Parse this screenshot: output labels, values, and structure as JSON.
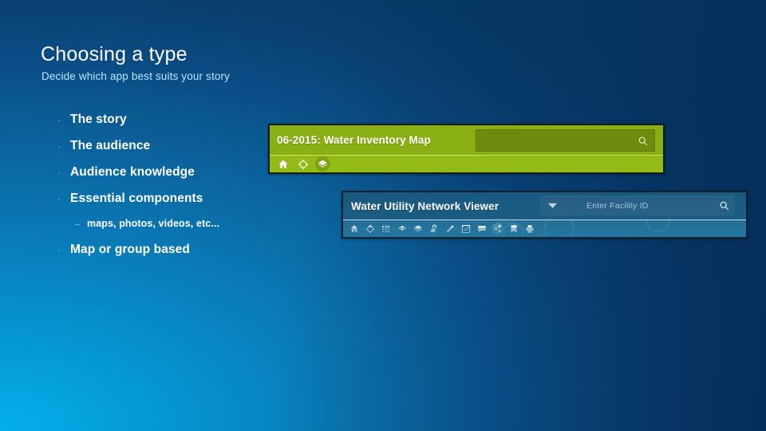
{
  "slide": {
    "title": "Choosing a type",
    "subtitle": "Decide which app best suits your story"
  },
  "bullets": [
    {
      "text": "The story",
      "level": 1,
      "marker": "·"
    },
    {
      "text": "The audience",
      "level": 1,
      "marker": "·"
    },
    {
      "text": "Audience knowledge",
      "level": 1,
      "marker": "·"
    },
    {
      "text": "Essential components",
      "level": 1,
      "marker": "·"
    },
    {
      "text": "maps, photos, videos, etc...",
      "level": 2,
      "marker": "–"
    },
    {
      "text": "Map or group based",
      "level": 1,
      "marker": "·"
    }
  ],
  "green_app": {
    "title": "06-2015: Water Inventory Map",
    "search_value": "",
    "search_placeholder": "",
    "search_icon": "search-icon",
    "toolbar_icons": [
      "home-icon",
      "locate-icon",
      "layers-icon"
    ],
    "colors": {
      "header": "#89b012",
      "toolbar": "#93bb16",
      "search_field": "#6c8c0b",
      "divider": "#c9e35a",
      "border": "#121a1e",
      "title_text": "#ffffff"
    }
  },
  "blue_app": {
    "title": "Water Utility Network Viewer",
    "search_value": "",
    "search_placeholder": "Enter Facility ID",
    "dropdown_icon": "chevron-down-icon",
    "search_icon": "search-icon",
    "toolbar_icons": [
      "home-icon",
      "locate-icon",
      "legend-icon",
      "basemap-icon",
      "layers-icon",
      "attachment-icon",
      "measure-icon",
      "edit-icon",
      "comment-icon",
      "share-icon",
      "bookmark-icon",
      "print-icon"
    ],
    "colors": {
      "header": "#17567c",
      "map": "#2e7ba2",
      "search_field": "#2e6486",
      "divider": "#d6eefa",
      "border": "#10202c",
      "title_text": "#ffffff",
      "placeholder_text": "#a8c6d8"
    }
  },
  "background": {
    "from": "#03b0ea",
    "to": "#063963",
    "accent": "#b7e6fb"
  }
}
